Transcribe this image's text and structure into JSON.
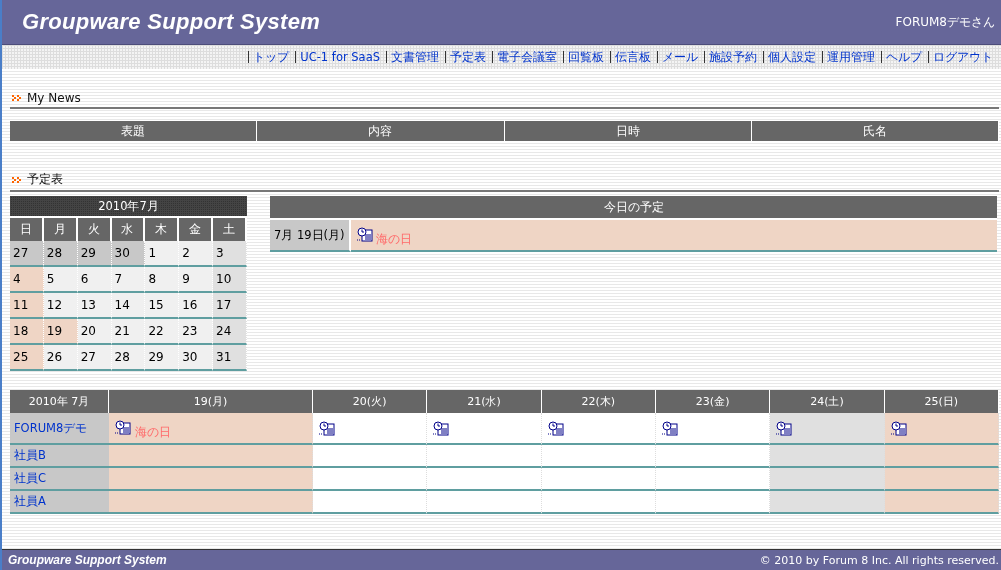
{
  "header": {
    "title": "Groupware Support System",
    "user": "FORUM8デモさん"
  },
  "nav": [
    "トップ",
    "UC-1 for SaaS",
    "文書管理",
    "予定表",
    "電子会議室",
    "回覧板",
    "伝言板",
    "メール",
    "施設予約",
    "個人設定",
    "運用管理",
    "ヘルプ",
    "ログアウト"
  ],
  "my_news": {
    "title": "My News",
    "columns": [
      "表題",
      "内容",
      "日時",
      "氏名"
    ]
  },
  "schedule": {
    "title": "予定表",
    "calendar": {
      "title": "2010年7月",
      "weekdays": [
        "日",
        "月",
        "火",
        "水",
        "木",
        "金",
        "土"
      ],
      "weeks": [
        [
          {
            "day": "27",
            "kind": "other"
          },
          {
            "day": "28",
            "kind": "other"
          },
          {
            "day": "29",
            "kind": "other"
          },
          {
            "day": "30",
            "kind": "other"
          },
          {
            "day": "1",
            "kind": "normal"
          },
          {
            "day": "2",
            "kind": "normal"
          },
          {
            "day": "3",
            "kind": "saturday"
          }
        ],
        [
          {
            "day": "4",
            "kind": "holiday"
          },
          {
            "day": "5",
            "kind": "normal"
          },
          {
            "day": "6",
            "kind": "normal"
          },
          {
            "day": "7",
            "kind": "normal"
          },
          {
            "day": "8",
            "kind": "normal"
          },
          {
            "day": "9",
            "kind": "normal"
          },
          {
            "day": "10",
            "kind": "saturday"
          }
        ],
        [
          {
            "day": "11",
            "kind": "holiday"
          },
          {
            "day": "12",
            "kind": "normal"
          },
          {
            "day": "13",
            "kind": "normal"
          },
          {
            "day": "14",
            "kind": "normal"
          },
          {
            "day": "15",
            "kind": "normal"
          },
          {
            "day": "16",
            "kind": "normal"
          },
          {
            "day": "17",
            "kind": "saturday"
          }
        ],
        [
          {
            "day": "18",
            "kind": "holiday"
          },
          {
            "day": "19",
            "kind": "holiday"
          },
          {
            "day": "20",
            "kind": "normal"
          },
          {
            "day": "21",
            "kind": "normal"
          },
          {
            "day": "22",
            "kind": "normal"
          },
          {
            "day": "23",
            "kind": "normal"
          },
          {
            "day": "24",
            "kind": "saturday"
          }
        ],
        [
          {
            "day": "25",
            "kind": "holiday"
          },
          {
            "day": "26",
            "kind": "normal"
          },
          {
            "day": "27",
            "kind": "normal"
          },
          {
            "day": "28",
            "kind": "normal"
          },
          {
            "day": "29",
            "kind": "normal"
          },
          {
            "day": "30",
            "kind": "normal"
          },
          {
            "day": "31",
            "kind": "saturday"
          }
        ]
      ]
    },
    "today": {
      "title": "今日の予定",
      "date": "7月 19日(月)",
      "event": "海の日"
    },
    "week": {
      "corner": "2010年 7月",
      "days": [
        {
          "label": "19(月)",
          "kind": "holiday"
        },
        {
          "label": "20(火)",
          "kind": "normal"
        },
        {
          "label": "21(水)",
          "kind": "normal"
        },
        {
          "label": "22(木)",
          "kind": "normal"
        },
        {
          "label": "23(金)",
          "kind": "normal"
        },
        {
          "label": "24(土)",
          "kind": "saturday"
        },
        {
          "label": "25(日)",
          "kind": "holiday"
        }
      ],
      "rows": [
        {
          "name": "FORUM8デモ",
          "cells": [
            {
              "icon": true,
              "event": "海の日"
            },
            {
              "icon": true
            },
            {
              "icon": true
            },
            {
              "icon": true
            },
            {
              "icon": true
            },
            {
              "icon": true
            },
            {
              "icon": true
            }
          ]
        },
        {
          "name": "社員B",
          "cells": [
            {
              "icon": false
            },
            {
              "icon": false
            },
            {
              "icon": false
            },
            {
              "icon": false
            },
            {
              "icon": false
            },
            {
              "icon": false
            },
            {
              "icon": false
            }
          ]
        },
        {
          "name": "社員C",
          "cells": [
            {
              "icon": false
            },
            {
              "icon": false
            },
            {
              "icon": false
            },
            {
              "icon": false
            },
            {
              "icon": false
            },
            {
              "icon": false
            },
            {
              "icon": false
            }
          ]
        },
        {
          "name": "社員A",
          "cells": [
            {
              "icon": false
            },
            {
              "icon": false
            },
            {
              "icon": false
            },
            {
              "icon": false
            },
            {
              "icon": false
            },
            {
              "icon": false
            },
            {
              "icon": false
            }
          ]
        }
      ]
    }
  },
  "footer": {
    "title": "Groupware Support System",
    "copyright": "© 2010 by Forum 8 Inc. All rights reserved."
  }
}
